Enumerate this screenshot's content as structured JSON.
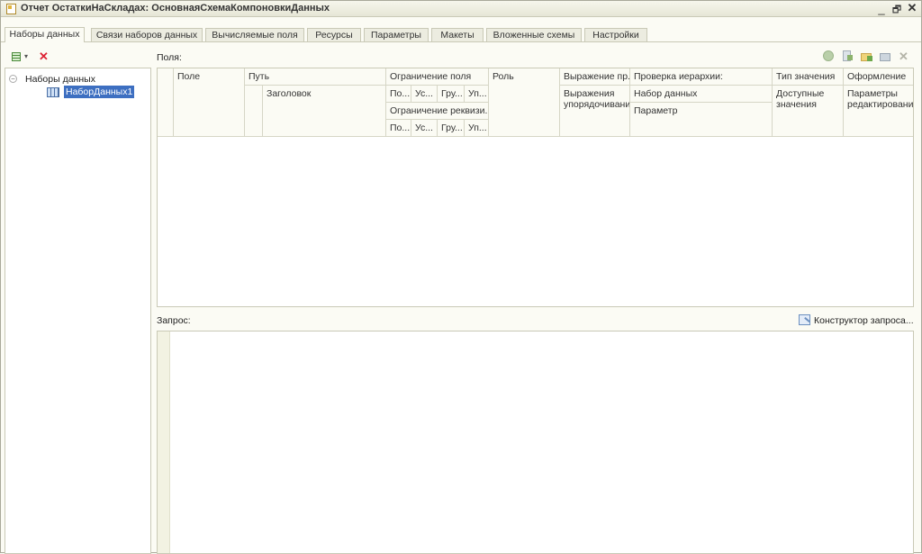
{
  "window": {
    "title": "Отчет ОстаткиНаСкладах: ОсновнаяСхемаКомпоновкиДанных",
    "minimize": "_",
    "restore": "🗗",
    "close": "✕"
  },
  "tabs": [
    {
      "label": "Наборы данных",
      "active": true
    },
    {
      "label": "Связи наборов данных"
    },
    {
      "label": "Вычисляемые поля"
    },
    {
      "label": "Ресурсы"
    },
    {
      "label": "Параметры"
    },
    {
      "label": "Макеты"
    },
    {
      "label": "Вложенные схемы"
    },
    {
      "label": "Настройки"
    }
  ],
  "tree": {
    "root": "Наборы данных",
    "items": [
      {
        "label": "НаборДанных1",
        "selected": true
      }
    ]
  },
  "fields": {
    "label": "Поля:",
    "columns": {
      "field": "Поле",
      "path": "Путь",
      "title": "Заголовок",
      "field_restriction": "Ограничение поля",
      "restr_sub": [
        "По...",
        "Ус...",
        "Гру...",
        "Уп..."
      ],
      "attr_restriction": "Ограничение реквизи...",
      "attr_sub": [
        "По...",
        "Ус...",
        "Гру...",
        "Уп..."
      ],
      "role": "Роль",
      "expression": "Выражение пр...",
      "expression_sub": "Выражения упорядочивани",
      "hierarchy": "Проверка иерархии:",
      "hierarchy_dataset": "Набор данных",
      "hierarchy_param": "Параметр",
      "value_type": "Тип значения",
      "value_type_sub": "Доступные значения",
      "appearance": "Оформление",
      "appearance_sub": "Параметры редактировани"
    }
  },
  "query": {
    "label": "Запрос:",
    "constructor_label": "Конструктор запроса..."
  },
  "colors": {
    "accent": "#3d6fc1",
    "panel": "#fbfbf4",
    "border": "#c9c9b6"
  }
}
